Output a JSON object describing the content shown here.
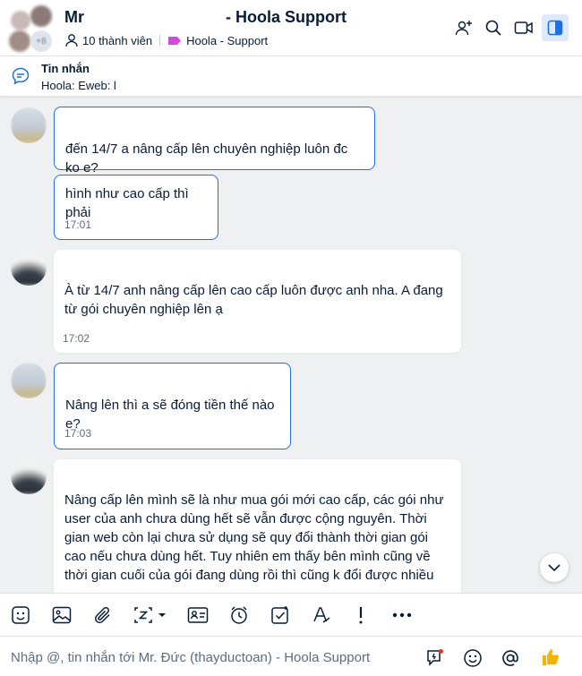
{
  "header": {
    "title_left": "Mr",
    "title_right": "- Hoola Support",
    "member_count": "10 thành viên",
    "tag_label": "Hoola - Support",
    "avatar_more": "+8"
  },
  "pinned": {
    "title": "Tin nhắn",
    "text": "Hoola: Eweb: l"
  },
  "messages": [
    {
      "sender": "mine",
      "text": "đến 14/7 a nâng cấp lên chuyên nghiệp luôn đc ko e?",
      "time": ""
    },
    {
      "sender": "mine",
      "text": "hình như cao cấp thì phải",
      "time": "17:01"
    },
    {
      "sender": "theirs",
      "text": "À từ 14/7 anh nâng cấp lên cao cấp luôn được anh nha. A đang từ gói chuyên nghiệp lên ạ",
      "time": "17:02"
    },
    {
      "sender": "mine",
      "text": "Nâng lên thì a sẽ đóng tiền thế nào e?",
      "time": "17:03"
    },
    {
      "sender": "theirs",
      "text": "Nâng cấp lên mình sẽ là như mua gói mới cao cấp, các gói như user của anh chưa dùng hết sẽ vẫn được cộng nguyên. Thời gian web còn lại chưa sử dụng sẽ quy đổi thành thời gian gói cao nếu chưa dùng hết. Tuy nhiên em thấy bên mình cũng về thời gian cuối của gói đang dùng rồi thì cũng k đổi được nhiều",
      "time": ""
    }
  ],
  "composer": {
    "placeholder": "Nhập @, tin nhắn tới Mr. Đức (thayductoan) - Hoola Support"
  },
  "colors": {
    "accent": "#1f6fe0",
    "background": "#eef0f1",
    "text": "#081c36",
    "like": "#f5b400"
  },
  "icons": {
    "header": [
      "add-member-icon",
      "search-icon",
      "video-call-icon",
      "sidebar-toggle-icon"
    ],
    "toolbar": [
      "sticker-icon",
      "image-icon",
      "attachment-icon",
      "screenshot-icon",
      "business-card-icon",
      "reminder-icon",
      "task-icon",
      "text-format-icon",
      "urgent-icon",
      "more-icon"
    ],
    "composer": [
      "quick-message-icon",
      "emoji-icon",
      "mention-icon",
      "like-icon"
    ]
  }
}
